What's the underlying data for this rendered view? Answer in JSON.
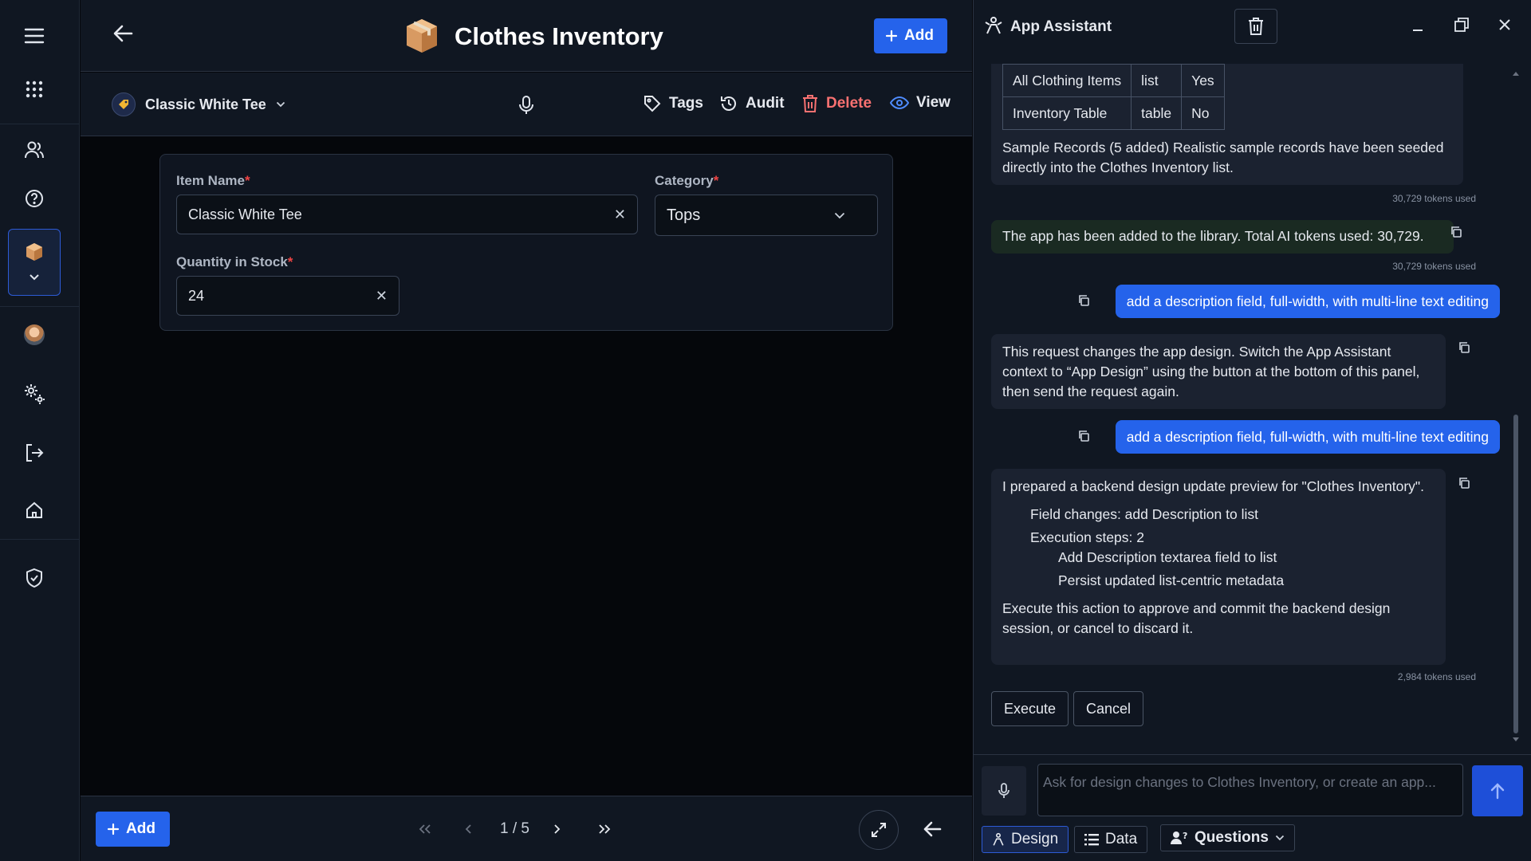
{
  "header": {
    "title": "Clothes Inventory",
    "add_label": "Add"
  },
  "toolbar": {
    "record_name": "Classic White Tee",
    "tags_label": "Tags",
    "audit_label": "Audit",
    "delete_label": "Delete",
    "view_label": "View"
  },
  "form": {
    "item_name_label": "Item Name",
    "item_name_value": "Classic White Tee",
    "category_label": "Category",
    "category_value": "Tops",
    "quantity_label": "Quantity in Stock",
    "quantity_value": "24",
    "required_mark": "*"
  },
  "footer": {
    "add_label": "Add",
    "page_indicator": "1 / 5"
  },
  "assistant": {
    "title": "App Assistant",
    "table_rows": [
      [
        "All Clothing Items",
        "list",
        "Yes"
      ],
      [
        "Inventory Table",
        "table",
        "No"
      ]
    ],
    "msg_sample_records": "Sample Records (5 added) Realistic sample records have been seeded directly into the Clothes Inventory list.",
    "tokens_1": "30,729 tokens used",
    "msg_added": "The app has been added to the library. Total AI tokens used: 30,729.",
    "tokens_2": "30,729 tokens used",
    "user_msg_1": "add a description field, full-width, with multi-line text editing",
    "msg_switch": "This request changes the app design. Switch the App Assistant context to “App Design” using the button at the bottom of this panel, then send the request again.",
    "user_msg_2": "add a description field, full-width, with multi-line text editing",
    "msg_prepared": "I prepared a backend design update preview for \"Clothes Inventory\".",
    "field_changes": "Field changes: add Description to list",
    "execution_steps": "Execution steps: 2",
    "step_1": "Add Description textarea field to list",
    "step_2": "Persist updated list-centric metadata",
    "msg_execute_note": "Execute this action to approve and commit the backend design session, or cancel to discard it.",
    "tokens_3": "2,984 tokens used",
    "execute_label": "Execute",
    "cancel_label": "Cancel",
    "input_placeholder": "Ask for design changes to Clothes Inventory, or create an app...",
    "tab_design": "Design",
    "tab_data": "Data",
    "tab_questions": "Questions"
  },
  "colors": {
    "accent": "#2563eb",
    "danger": "#f87171",
    "background": "#05070b",
    "panel": "#101722"
  }
}
